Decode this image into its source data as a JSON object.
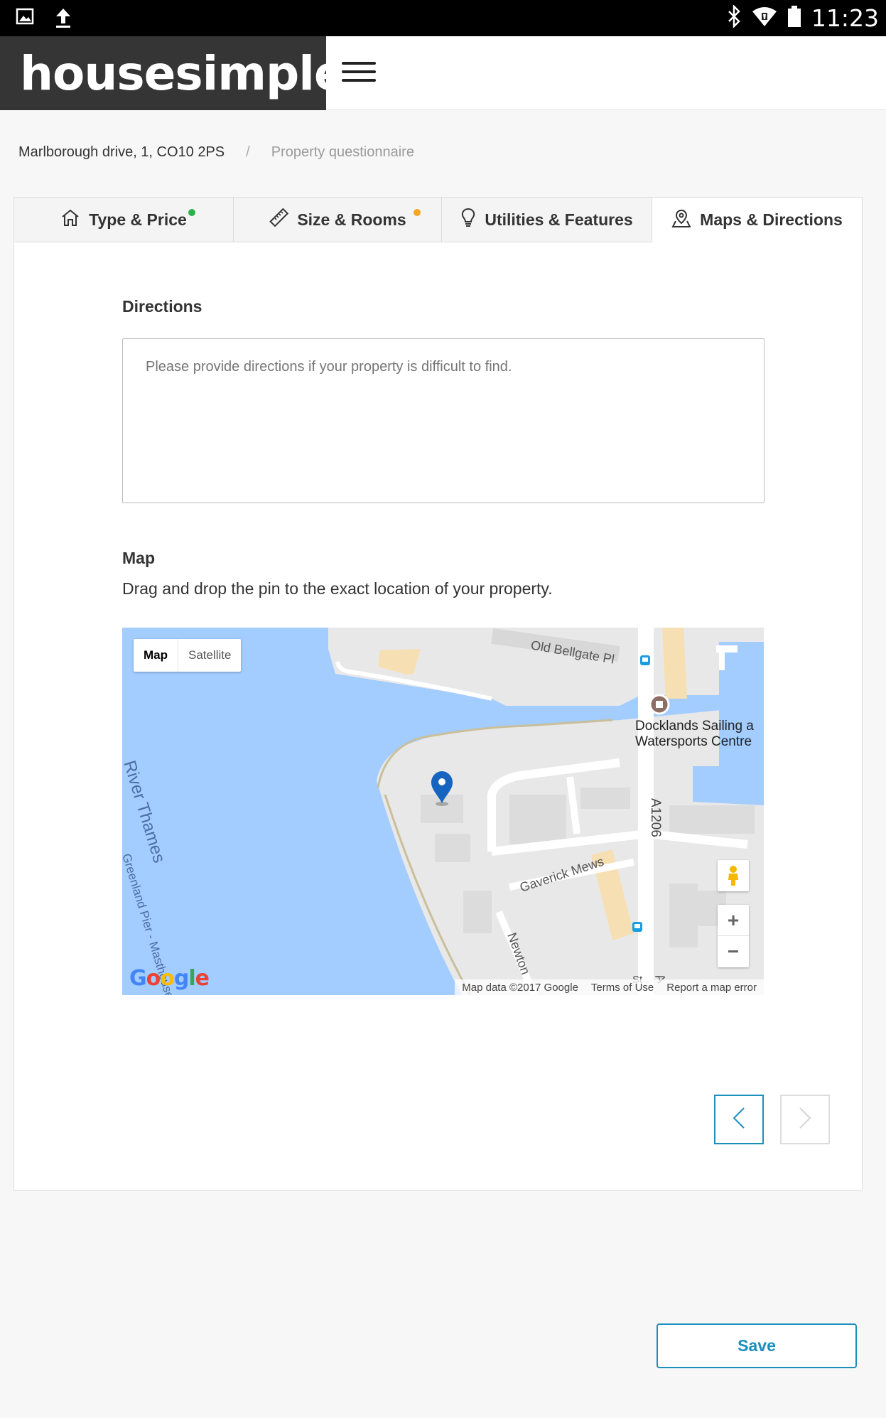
{
  "status_bar": {
    "time": "11:23",
    "left_icons": [
      "image-icon",
      "upload-icon"
    ],
    "right_icons": [
      "bluetooth-icon",
      "wifi-icon",
      "battery-icon"
    ]
  },
  "header": {
    "logo": "housesimple",
    "menu_icon": "hamburger-menu-icon"
  },
  "breadcrumb": {
    "items": [
      "Marlborough drive, 1, CO10 2PS",
      "Property questionnaire"
    ],
    "separator": "/"
  },
  "tabs": [
    {
      "label": "Type & Price",
      "icon": "home-icon",
      "status": "complete",
      "status_color": "#2bb24c"
    },
    {
      "label": "Size & Rooms",
      "icon": "ruler-icon",
      "status": "incomplete",
      "status_color": "#f5a623"
    },
    {
      "label": "Utilities & Features",
      "icon": "lightbulb-icon"
    },
    {
      "label": "Maps & Directions",
      "icon": "map-pin-icon",
      "active": true
    }
  ],
  "directions": {
    "title": "Directions",
    "placeholder": "Please provide directions if your property is difficult to find."
  },
  "map_section": {
    "title": "Map",
    "description": "Drag and drop the pin to the exact location of your property.",
    "type_toggle": {
      "map": "Map",
      "satellite": "Satellite",
      "selected": "Map"
    },
    "labels": {
      "street1": "Old Bellgate Pl",
      "poi_line1": "Docklands Sailing a",
      "poi_line2": "Watersports Centre",
      "road": "A1206",
      "river": "River Thames",
      "pier": "Greenland Pier - Masthouse",
      "street2": "Gaverick Mews",
      "street3": "Newton",
      "road_end": "A",
      "partial_st": "St"
    },
    "zoom_in": "+",
    "zoom_out": "−",
    "google_logo": "Google",
    "attribution": {
      "map_data": "Map data ©2017 Google",
      "terms": "Terms of Use",
      "report": "Report a map error"
    }
  },
  "navigation": {
    "prev_icon": "chevron-left-icon",
    "next_icon": "chevron-right-icon",
    "next_enabled": false
  },
  "save_button": "Save",
  "colors": {
    "accent": "#1b8fbd",
    "header_dark": "#353535",
    "water": "#a3ccff",
    "land": "#e8e8e8",
    "pin": "#1565c0"
  }
}
